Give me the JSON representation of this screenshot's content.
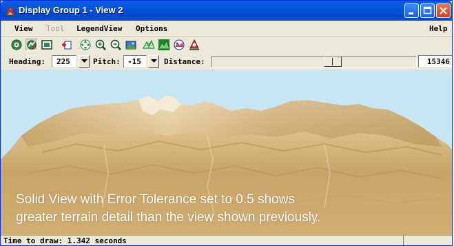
{
  "window": {
    "title": "Display Group 1 - View 2",
    "title_bar_color": "#0454d8",
    "controls": {
      "minimize": "minimize-icon",
      "maximize": "maximize-icon",
      "close": "close-icon"
    }
  },
  "menu": {
    "items": [
      {
        "label": "View",
        "enabled": true
      },
      {
        "label": "Tool",
        "enabled": false
      },
      {
        "label": "LegendView",
        "enabled": true
      },
      {
        "label": "Options",
        "enabled": true
      }
    ],
    "help": "Help"
  },
  "toolbar": {
    "icons": [
      "view-zoom-icon",
      "view-render-icon",
      "frame-icon",
      "add-layer-icon",
      "pan-icon",
      "zoom-in-icon",
      "zoom-out-icon",
      "photo-icon",
      "wireframe-icon",
      "solid-terrain-icon",
      "color-terrain-icon",
      "viewer-position-icon"
    ],
    "active_index": 1
  },
  "controls": {
    "heading_label": "Heading:",
    "heading_value": "225",
    "pitch_label": "Pitch:",
    "pitch_value": "-15",
    "distance_label": "Distance:",
    "distance_value": "15346",
    "distance_slider_fraction": 0.6
  },
  "view": {
    "sky_color": "#c7e6f4",
    "terrain_light": "#f3e1c0",
    "terrain_dark": "#b8935d",
    "caption_line1": "Solid View with Error Tolerance set to 0.5 shows",
    "caption_line2": "greater terrain detail than the view shown previously."
  },
  "status": {
    "text": "Time to draw: 1.342 seconds"
  }
}
